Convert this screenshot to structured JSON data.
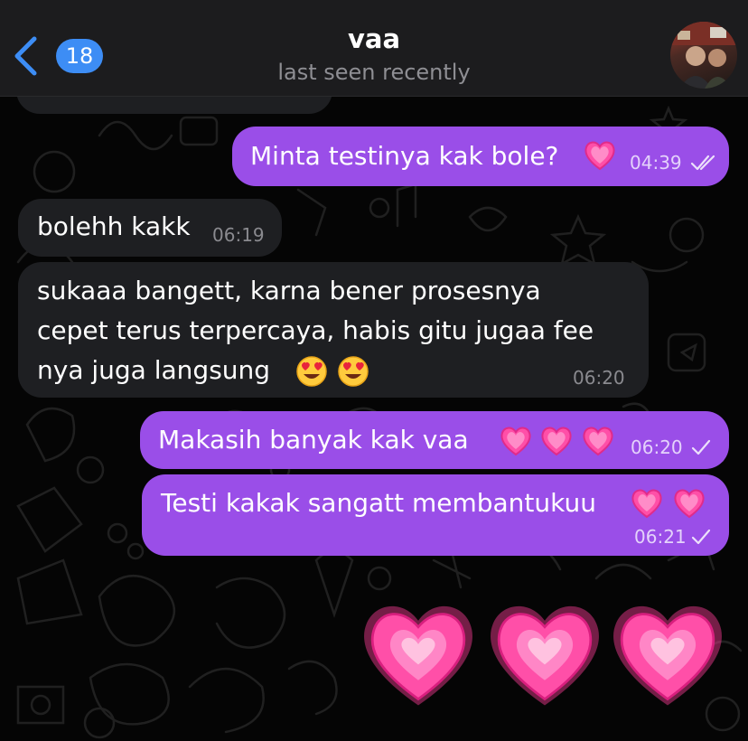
{
  "header": {
    "unread_count": "18",
    "contact_name": "vaa",
    "status": "last seen recently"
  },
  "messages": [
    {
      "direction": "out",
      "text": "Minta testinya kak bole?",
      "emoji": [
        "growing-heart"
      ],
      "time": "04:39",
      "status": "read"
    },
    {
      "direction": "in",
      "text": "bolehh kakk",
      "time": "06:19"
    },
    {
      "direction": "in",
      "lines": [
        "sukaaa bangett, karna bener prosesnya",
        "cepet terus terpercaya, habis gitu jugaa fee",
        "nya juga langsung"
      ],
      "emoji": [
        "heart-eyes-face",
        "heart-eyes-face"
      ],
      "time": "06:20"
    },
    {
      "direction": "out",
      "text": "Makasih banyak kak vaa",
      "emoji": [
        "growing-heart",
        "growing-heart",
        "growing-heart"
      ],
      "time": "06:20",
      "status": "sent"
    },
    {
      "direction": "out",
      "text": "Testi kakak sangatt membantukuu",
      "emoji": [
        "growing-heart",
        "growing-heart"
      ],
      "time": "06:21",
      "status": "sent"
    },
    {
      "direction": "out",
      "type": "big-emoji",
      "emoji": [
        "growing-heart",
        "growing-heart",
        "growing-heart"
      ]
    }
  ],
  "colors": {
    "outgoing_bubble": "#9a4ee8",
    "incoming_bubble": "#1e1f22",
    "header": "#1c1c1e",
    "accent": "#3d8df5",
    "heart": "#ff4fa8"
  },
  "icons": {
    "back": "chevron-left-icon",
    "read_status": "double-check-icon",
    "sent_status": "single-check-icon"
  }
}
